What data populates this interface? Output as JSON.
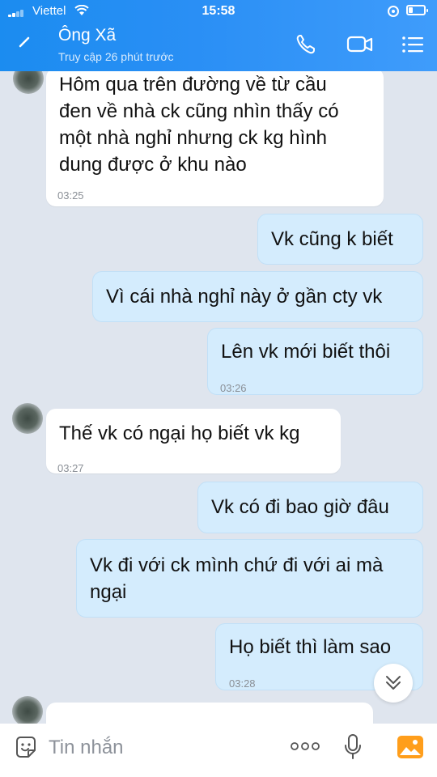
{
  "status_bar": {
    "carrier": "Viettel",
    "time": "15:58"
  },
  "header": {
    "contact_name": "Ông Xã",
    "last_seen": "Truy cập 26 phút trước"
  },
  "messages": [
    {
      "direction": "in",
      "lines": [
        "Hôm qua trên đường về từ cầu",
        "đen về nhà ck cũng nhìn thấy có",
        "một nhà nghỉ nhưng ck kg hình",
        "dung được ở khu nào"
      ],
      "time": "03:25"
    },
    {
      "direction": "out",
      "lines": [
        "Vk cũng k biết"
      ]
    },
    {
      "direction": "out",
      "lines": [
        "Vì cái nhà nghỉ này ở gần cty vk"
      ]
    },
    {
      "direction": "out",
      "lines": [
        "Lên vk mới biết thôi"
      ],
      "time": "03:26"
    },
    {
      "direction": "in",
      "lines": [
        "Thế vk có ngại họ biết vk kg"
      ],
      "time": "03:27"
    },
    {
      "direction": "out",
      "lines": [
        "Vk có đi bao giờ đâu"
      ]
    },
    {
      "direction": "out",
      "lines": [
        "Vk đi với ck mình chứ đi với ai mà",
        "ngại"
      ]
    },
    {
      "direction": "out",
      "lines": [
        "Họ biết thì làm sao"
      ],
      "time": "03:28"
    }
  ],
  "composer": {
    "placeholder": "Tin nhắn"
  },
  "icons": {
    "back": "chevron-left-icon",
    "call": "phone-icon",
    "video": "video-camera-icon",
    "menu": "menu-list-icon",
    "emoji": "sticker-icon",
    "more": "more-dots-icon",
    "mic": "microphone-icon",
    "photo": "image-icon",
    "scroll": "chevron-double-down-icon"
  },
  "colors": {
    "header_blue": "#2a8ff5",
    "outgoing_bubble": "#d4ecfd",
    "incoming_bubble": "#ffffff",
    "chat_background": "#dfe5ee"
  }
}
